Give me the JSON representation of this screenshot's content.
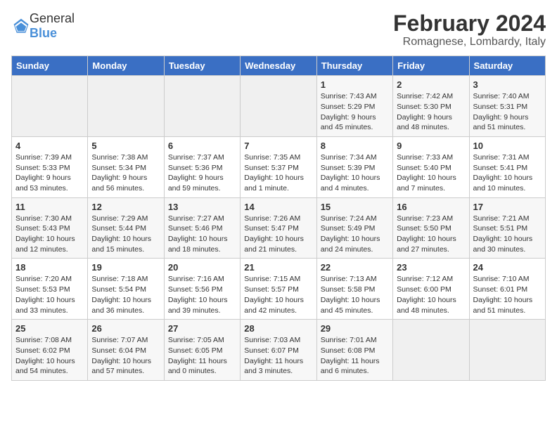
{
  "header": {
    "logo": {
      "general": "General",
      "blue": "Blue"
    },
    "title": "February 2024",
    "subtitle": "Romagnese, Lombardy, Italy"
  },
  "days_of_week": [
    "Sunday",
    "Monday",
    "Tuesday",
    "Wednesday",
    "Thursday",
    "Friday",
    "Saturday"
  ],
  "weeks": [
    [
      {
        "day": "",
        "info": ""
      },
      {
        "day": "",
        "info": ""
      },
      {
        "day": "",
        "info": ""
      },
      {
        "day": "",
        "info": ""
      },
      {
        "day": "1",
        "info": "Sunrise: 7:43 AM\nSunset: 5:29 PM\nDaylight: 9 hours\nand 45 minutes."
      },
      {
        "day": "2",
        "info": "Sunrise: 7:42 AM\nSunset: 5:30 PM\nDaylight: 9 hours\nand 48 minutes."
      },
      {
        "day": "3",
        "info": "Sunrise: 7:40 AM\nSunset: 5:31 PM\nDaylight: 9 hours\nand 51 minutes."
      }
    ],
    [
      {
        "day": "4",
        "info": "Sunrise: 7:39 AM\nSunset: 5:33 PM\nDaylight: 9 hours\nand 53 minutes."
      },
      {
        "day": "5",
        "info": "Sunrise: 7:38 AM\nSunset: 5:34 PM\nDaylight: 9 hours\nand 56 minutes."
      },
      {
        "day": "6",
        "info": "Sunrise: 7:37 AM\nSunset: 5:36 PM\nDaylight: 9 hours\nand 59 minutes."
      },
      {
        "day": "7",
        "info": "Sunrise: 7:35 AM\nSunset: 5:37 PM\nDaylight: 10 hours\nand 1 minute."
      },
      {
        "day": "8",
        "info": "Sunrise: 7:34 AM\nSunset: 5:39 PM\nDaylight: 10 hours\nand 4 minutes."
      },
      {
        "day": "9",
        "info": "Sunrise: 7:33 AM\nSunset: 5:40 PM\nDaylight: 10 hours\nand 7 minutes."
      },
      {
        "day": "10",
        "info": "Sunrise: 7:31 AM\nSunset: 5:41 PM\nDaylight: 10 hours\nand 10 minutes."
      }
    ],
    [
      {
        "day": "11",
        "info": "Sunrise: 7:30 AM\nSunset: 5:43 PM\nDaylight: 10 hours\nand 12 minutes."
      },
      {
        "day": "12",
        "info": "Sunrise: 7:29 AM\nSunset: 5:44 PM\nDaylight: 10 hours\nand 15 minutes."
      },
      {
        "day": "13",
        "info": "Sunrise: 7:27 AM\nSunset: 5:46 PM\nDaylight: 10 hours\nand 18 minutes."
      },
      {
        "day": "14",
        "info": "Sunrise: 7:26 AM\nSunset: 5:47 PM\nDaylight: 10 hours\nand 21 minutes."
      },
      {
        "day": "15",
        "info": "Sunrise: 7:24 AM\nSunset: 5:49 PM\nDaylight: 10 hours\nand 24 minutes."
      },
      {
        "day": "16",
        "info": "Sunrise: 7:23 AM\nSunset: 5:50 PM\nDaylight: 10 hours\nand 27 minutes."
      },
      {
        "day": "17",
        "info": "Sunrise: 7:21 AM\nSunset: 5:51 PM\nDaylight: 10 hours\nand 30 minutes."
      }
    ],
    [
      {
        "day": "18",
        "info": "Sunrise: 7:20 AM\nSunset: 5:53 PM\nDaylight: 10 hours\nand 33 minutes."
      },
      {
        "day": "19",
        "info": "Sunrise: 7:18 AM\nSunset: 5:54 PM\nDaylight: 10 hours\nand 36 minutes."
      },
      {
        "day": "20",
        "info": "Sunrise: 7:16 AM\nSunset: 5:56 PM\nDaylight: 10 hours\nand 39 minutes."
      },
      {
        "day": "21",
        "info": "Sunrise: 7:15 AM\nSunset: 5:57 PM\nDaylight: 10 hours\nand 42 minutes."
      },
      {
        "day": "22",
        "info": "Sunrise: 7:13 AM\nSunset: 5:58 PM\nDaylight: 10 hours\nand 45 minutes."
      },
      {
        "day": "23",
        "info": "Sunrise: 7:12 AM\nSunset: 6:00 PM\nDaylight: 10 hours\nand 48 minutes."
      },
      {
        "day": "24",
        "info": "Sunrise: 7:10 AM\nSunset: 6:01 PM\nDaylight: 10 hours\nand 51 minutes."
      }
    ],
    [
      {
        "day": "25",
        "info": "Sunrise: 7:08 AM\nSunset: 6:02 PM\nDaylight: 10 hours\nand 54 minutes."
      },
      {
        "day": "26",
        "info": "Sunrise: 7:07 AM\nSunset: 6:04 PM\nDaylight: 10 hours\nand 57 minutes."
      },
      {
        "day": "27",
        "info": "Sunrise: 7:05 AM\nSunset: 6:05 PM\nDaylight: 11 hours\nand 0 minutes."
      },
      {
        "day": "28",
        "info": "Sunrise: 7:03 AM\nSunset: 6:07 PM\nDaylight: 11 hours\nand 3 minutes."
      },
      {
        "day": "29",
        "info": "Sunrise: 7:01 AM\nSunset: 6:08 PM\nDaylight: 11 hours\nand 6 minutes."
      },
      {
        "day": "",
        "info": ""
      },
      {
        "day": "",
        "info": ""
      }
    ]
  ]
}
